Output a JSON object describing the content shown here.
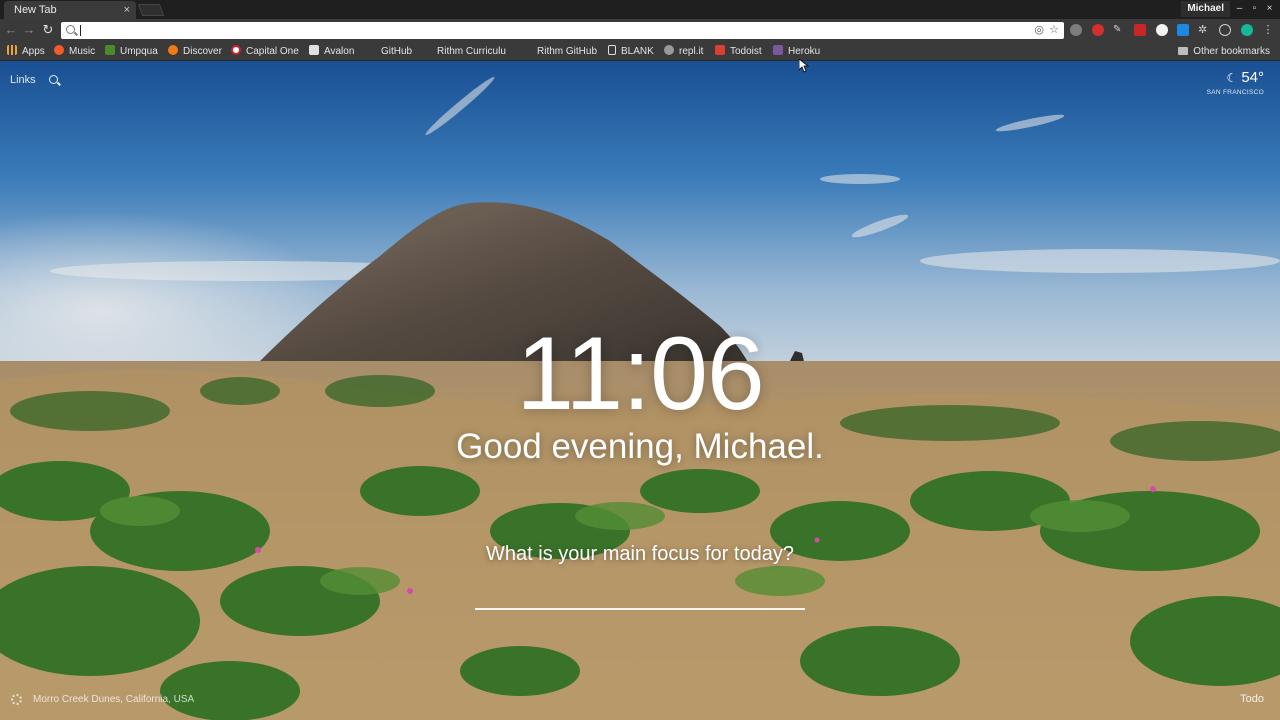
{
  "browser": {
    "tab": {
      "title": "New Tab",
      "close_glyph": "×"
    },
    "profile_name": "Michael",
    "window_controls": [
      "–",
      "▫",
      "×"
    ],
    "omnibox": {
      "value": "",
      "placeholder": ""
    },
    "bookmarks": [
      {
        "label": "Apps",
        "icon": "apps-grid-icon",
        "color": "#e8a33d"
      },
      {
        "label": "Music",
        "icon": "music-icon",
        "color": "#f45b2a"
      },
      {
        "label": "Umpqua",
        "icon": "umpqua-icon",
        "color": "#4a8c2a"
      },
      {
        "label": "Discover",
        "icon": "discover-icon",
        "color": "#f07a16"
      },
      {
        "label": "Capital One",
        "icon": "capital-one-icon",
        "color": "#d12030"
      },
      {
        "label": "Avalon",
        "icon": "avalon-icon",
        "color": "#e0e0e0"
      },
      {
        "label": "GitHub",
        "icon": "github-icon",
        "color": "#3a3a3a"
      },
      {
        "label": "Rithm Curriculu",
        "icon": "rithm-icon",
        "color": "#3a3a3a"
      },
      {
        "label": "Rithm GitHub",
        "icon": "github-icon",
        "color": "#3a3a3a"
      },
      {
        "label": "BLANK",
        "icon": "page-icon",
        "color": "#e0e0e0"
      },
      {
        "label": "repl.it",
        "icon": "replit-icon",
        "color": "#9a9a9a"
      },
      {
        "label": "Todoist",
        "icon": "todoist-icon",
        "color": "#db4035"
      },
      {
        "label": "Heroku",
        "icon": "heroku-icon",
        "color": "#79589f"
      }
    ],
    "other_bookmarks": "Other bookmarks"
  },
  "momentum": {
    "links_label": "Links",
    "weather": {
      "temperature": "54°",
      "location": "SAN FRANCISCO"
    },
    "time": "11:06",
    "greeting": "Good evening, Michael.",
    "focus_question": "What is your main focus for today?",
    "focus_value": "",
    "photo_credit": "Morro Creek Dunes, California, USA",
    "todo_label": "Todo"
  },
  "colors": {
    "sky_top": "#1f5fa8",
    "sky_horizon": "#dbe7f2",
    "sand": "#c9a877",
    "plant": "#3e7d2d"
  }
}
